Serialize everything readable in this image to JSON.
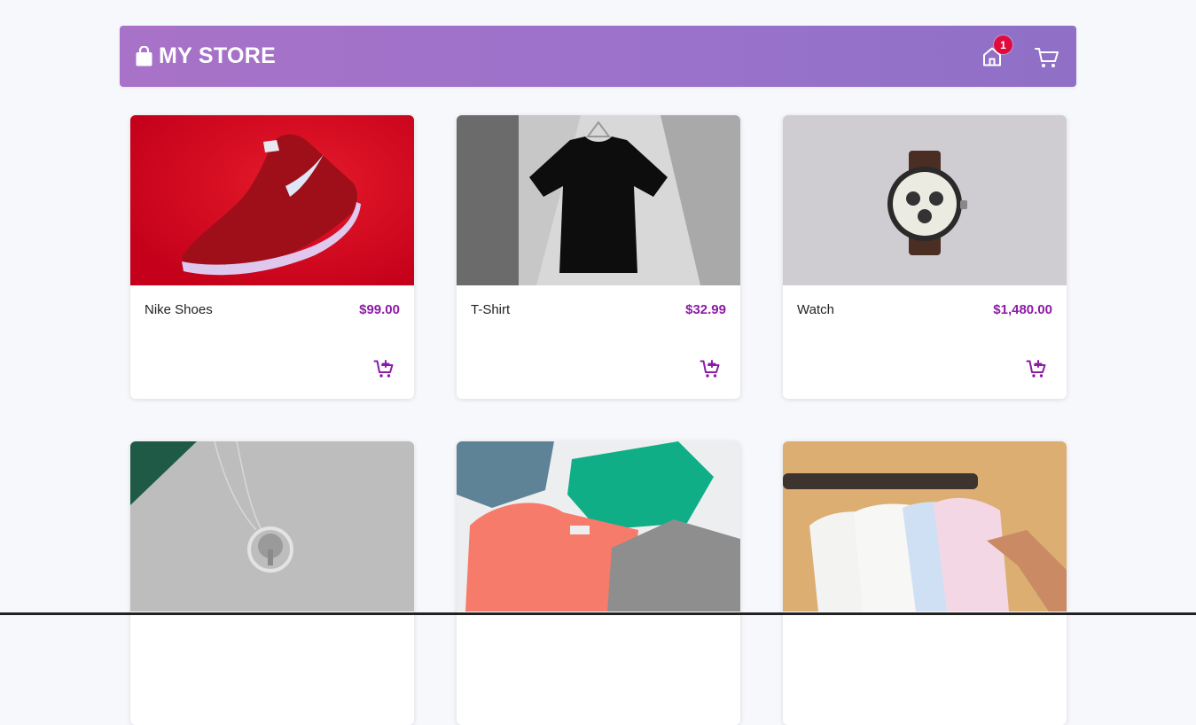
{
  "header": {
    "title": "MY STORE",
    "cart_count": "1",
    "accent_color": "#9a72cb",
    "badge_color": "#e00b3c"
  },
  "products": [
    {
      "name": "Nike Shoes",
      "price": "$99.00",
      "image": "red-sneaker"
    },
    {
      "name": "T-Shirt",
      "price": "$32.99",
      "image": "black-tshirt"
    },
    {
      "name": "Watch",
      "price": "$1,480.00",
      "image": "wristwatch"
    },
    {
      "name": "",
      "price": "",
      "image": "tree-pendant-necklace"
    },
    {
      "name": "",
      "price": "",
      "image": "folded-polo-shirts"
    },
    {
      "name": "",
      "price": "",
      "image": "dress-shirts-on-hangers"
    }
  ],
  "price_color": "#8c1ba6"
}
